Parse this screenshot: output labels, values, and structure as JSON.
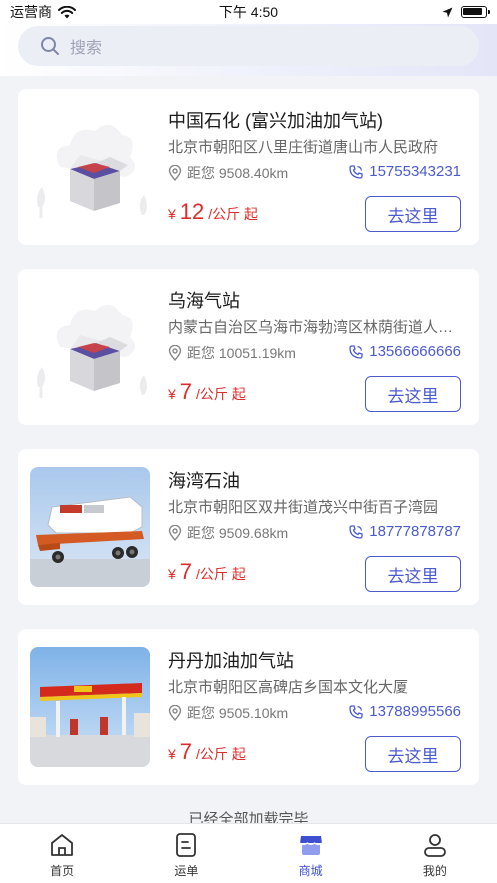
{
  "status_bar": {
    "carrier": "运营商",
    "time": "下午 4:50"
  },
  "search": {
    "placeholder": "搜索"
  },
  "stations": [
    {
      "name": "中国石化 (富兴加油加气站)",
      "address": "北京市朝阳区八里庄街道唐山市人民政府",
      "distance": "距您 9508.40km",
      "phone": "15755343231",
      "price_symbol": "¥",
      "price_value": "12",
      "price_unit": "/公斤 起",
      "go_label": "去这里",
      "image": "placeholder"
    },
    {
      "name": "乌海气站",
      "address": "内蒙古自治区乌海市海勃湾区林荫街道人民路",
      "distance": "距您 10051.19km",
      "phone": "13566666666",
      "price_symbol": "¥",
      "price_value": "7",
      "price_unit": "/公斤 起",
      "go_label": "去这里",
      "image": "placeholder"
    },
    {
      "name": "海湾石油",
      "address": "北京市朝阳区双井街道茂兴中街百子湾园",
      "distance": "距您 9509.68km",
      "phone": "18777878787",
      "price_symbol": "¥",
      "price_value": "7",
      "price_unit": "/公斤 起",
      "go_label": "去这里",
      "image": "tanker-truck"
    },
    {
      "name": "丹丹加油加气站",
      "address": "北京市朝阳区高碑店乡国本文化大厦",
      "distance": "距您 9505.10km",
      "phone": "13788995566",
      "price_symbol": "¥",
      "price_value": "7",
      "price_unit": "/公斤 起",
      "go_label": "去这里",
      "image": "gas-station"
    }
  ],
  "list_end_text": "已经全部加载完毕",
  "tabbar": {
    "items": [
      {
        "label": "首页",
        "icon": "home-icon"
      },
      {
        "label": "运单",
        "icon": "waybill-icon"
      },
      {
        "label": "商城",
        "icon": "store-icon",
        "active": true
      },
      {
        "label": "我的",
        "icon": "user-icon"
      }
    ]
  },
  "colors": {
    "accent": "#4a5bd0",
    "price": "#e02b2b",
    "background": "#f2f3f7"
  }
}
